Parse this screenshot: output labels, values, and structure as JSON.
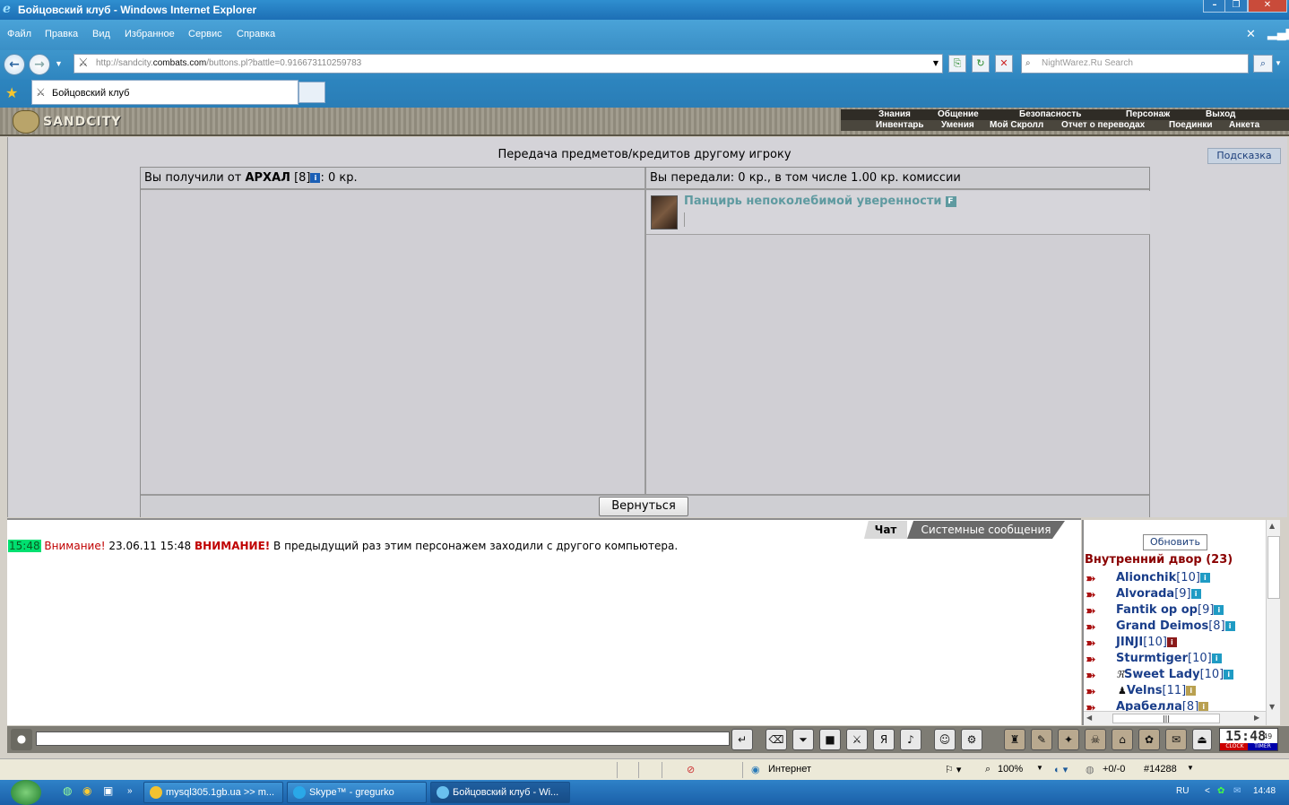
{
  "window": {
    "title": "Бойцовский клуб - Windows Internet Explorer"
  },
  "menu": [
    "Файл",
    "Правка",
    "Вид",
    "Избранное",
    "Сервис",
    "Справка"
  ],
  "address": {
    "url_prefix": "http://sandcity.",
    "url_domain": "combats.com",
    "url_path": "/buttons.pl?battle=0.916673110259783"
  },
  "search": {
    "placeholder": "NightWarez.Ru Search"
  },
  "tab": {
    "title": "Бойцовский клуб"
  },
  "game": {
    "logo": "SANDCITY",
    "nav_top": [
      "Знания",
      "Общение",
      "Безопасность",
      "Персонаж",
      "Выход"
    ],
    "nav_bottom": [
      "Инвентарь",
      "Умения",
      "Мой Скролл",
      "Отчет о переводах",
      "Поединки",
      "Анкета"
    ]
  },
  "transfer": {
    "title": "Передача предметов/кредитов другому игроку",
    "hint_button": "Подсказка",
    "received_prefix": "Вы получили от ",
    "received_from": "АРХАЛ",
    "received_level": " [8]",
    "received_amount": ": 0 кр.",
    "given_text": "Вы передали: 0 кр., в том числе 1.00 кр. комиссии",
    "item_name": "Панцирь непоколебимой уверенности",
    "item_badge": "F",
    "back_button": "Вернуться"
  },
  "chat": {
    "tab_chat": "Чат",
    "tab_system": "Системные сообщения",
    "message": {
      "time": "15:48",
      "label": "Внимание!",
      "date": " 23.06.11 15:48 ",
      "label_bold": "ВНИМАНИЕ!",
      "text": " В предыдущий раз этим персонажем заходили с другого компьютера."
    }
  },
  "room": {
    "refresh_button": "Обновить",
    "name": "Внутренний двор (23)",
    "users": [
      {
        "name": "Alionchik",
        "level": "[10]"
      },
      {
        "name": "Alvorada",
        "level": "[9]"
      },
      {
        "name": "Fantik op op",
        "level": "[9]"
      },
      {
        "name": "Grand Deimos",
        "level": "[8]"
      },
      {
        "name": "JINJI",
        "level": "[10]"
      },
      {
        "name": "Sturmtiger",
        "level": "[10]"
      },
      {
        "name": "Sweet Lady",
        "level": "[10]"
      },
      {
        "name": "Velns",
        "level": "[11]"
      },
      {
        "name": "Арабелла",
        "level": "[8]"
      }
    ]
  },
  "clock": {
    "time": "15:48",
    "seconds": "49",
    "clock_label": "CLOCK",
    "timer_label": "TIMER"
  },
  "statusbar": {
    "zone": "Интернет",
    "zoom": "100%",
    "counter": "+0/-0",
    "id": "#14288"
  },
  "taskbar": {
    "tasks": [
      "mysql305.1gb.ua >> m...",
      "Skype™ - gregurko",
      "Бойцовский клуб - Wi..."
    ],
    "lang": "RU",
    "time": "14:48"
  },
  "colors": {
    "accent": "#2f8fd0",
    "room_name": "#8a0000",
    "user_link": "#1a3e8a",
    "item_link": "#5f9aa0",
    "warning": "#c00000"
  }
}
